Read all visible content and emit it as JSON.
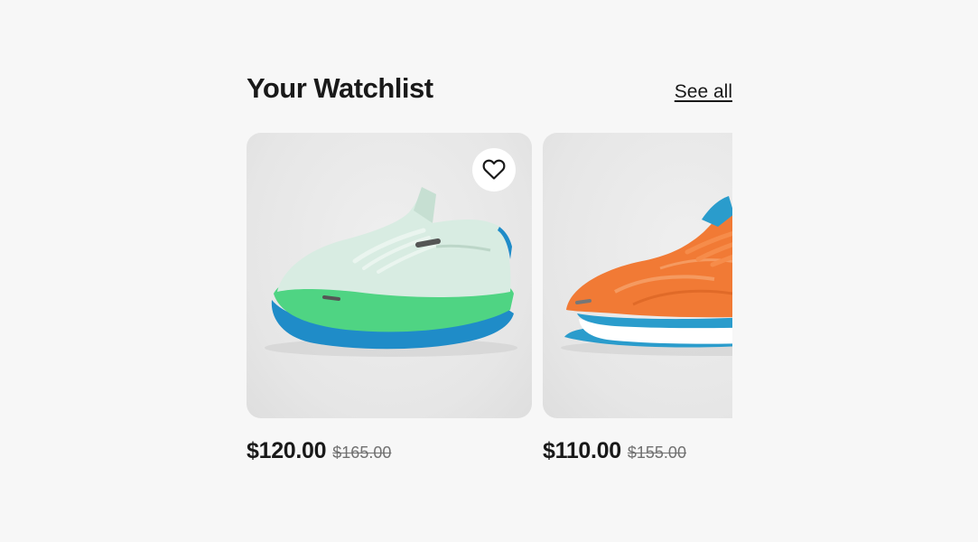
{
  "watchlist": {
    "title": "Your Watchlist",
    "see_all_label": "See all",
    "watch_icon": "heart-outline-icon",
    "items": [
      {
        "product": "mint-green-running-shoe",
        "colors": {
          "upper": "#d8ece2",
          "midsole": "#4fd483",
          "outsole": "#1f8cc8"
        },
        "price": "$120.00",
        "original_price": "$165.00"
      },
      {
        "product": "orange-running-shoe",
        "colors": {
          "upper": "#f17a35",
          "midsole": "#ffffff",
          "outsole": "#2a9ccc"
        },
        "price": "$110.00",
        "original_price": "$155.00"
      }
    ]
  }
}
